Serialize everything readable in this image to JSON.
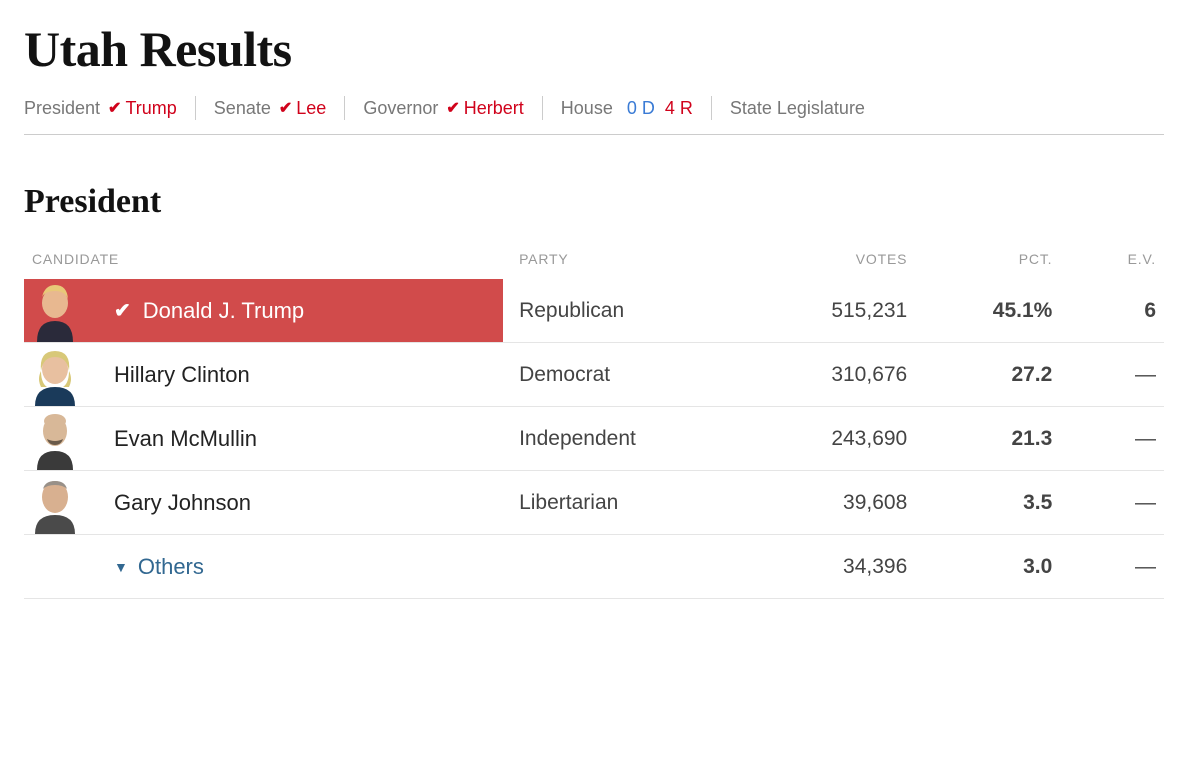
{
  "title": "Utah Results",
  "nav": {
    "president": {
      "label": "President",
      "winner": "Trump"
    },
    "senate": {
      "label": "Senate",
      "winner": "Lee"
    },
    "governor": {
      "label": "Governor",
      "winner": "Herbert"
    },
    "house": {
      "label": "House",
      "dem": "0 D",
      "rep": "4 R"
    },
    "state_leg": {
      "label": "State Legislature"
    }
  },
  "section_title": "President",
  "headers": {
    "candidate": "Candidate",
    "party": "Party",
    "votes": "Votes",
    "pct": "Pct.",
    "ev": "E.V."
  },
  "rows": [
    {
      "name": "Donald J. Trump",
      "party": "Republican",
      "votes": "515,231",
      "pct": "45.1%",
      "ev": "6",
      "winner": true,
      "bar_width": "100%"
    },
    {
      "name": "Hillary Clinton",
      "party": "Democrat",
      "votes": "310,676",
      "pct": "27.2",
      "ev": "—",
      "winner": false
    },
    {
      "name": "Evan McMullin",
      "party": "Independent",
      "votes": "243,690",
      "pct": "21.3",
      "ev": "—",
      "winner": false
    },
    {
      "name": "Gary Johnson",
      "party": "Libertarian",
      "votes": "39,608",
      "pct": "3.5",
      "ev": "—",
      "winner": false
    }
  ],
  "others": {
    "label": "Others",
    "votes": "34,396",
    "pct": "3.0",
    "ev": "—"
  },
  "colors": {
    "rep": "#d0021b",
    "dem": "#3a7bd5",
    "winner_bar": "#d14b4b"
  },
  "chart_data": {
    "type": "table",
    "title": "Utah Results — President",
    "columns": [
      "Candidate",
      "Party",
      "Votes",
      "Pct.",
      "E.V."
    ],
    "rows": [
      [
        "Donald J. Trump",
        "Republican",
        515231,
        45.1,
        6
      ],
      [
        "Hillary Clinton",
        "Democrat",
        310676,
        27.2,
        null
      ],
      [
        "Evan McMullin",
        "Independent",
        243690,
        21.3,
        null
      ],
      [
        "Gary Johnson",
        "Libertarian",
        39608,
        3.5,
        null
      ],
      [
        "Others",
        null,
        34396,
        3.0,
        null
      ]
    ]
  }
}
